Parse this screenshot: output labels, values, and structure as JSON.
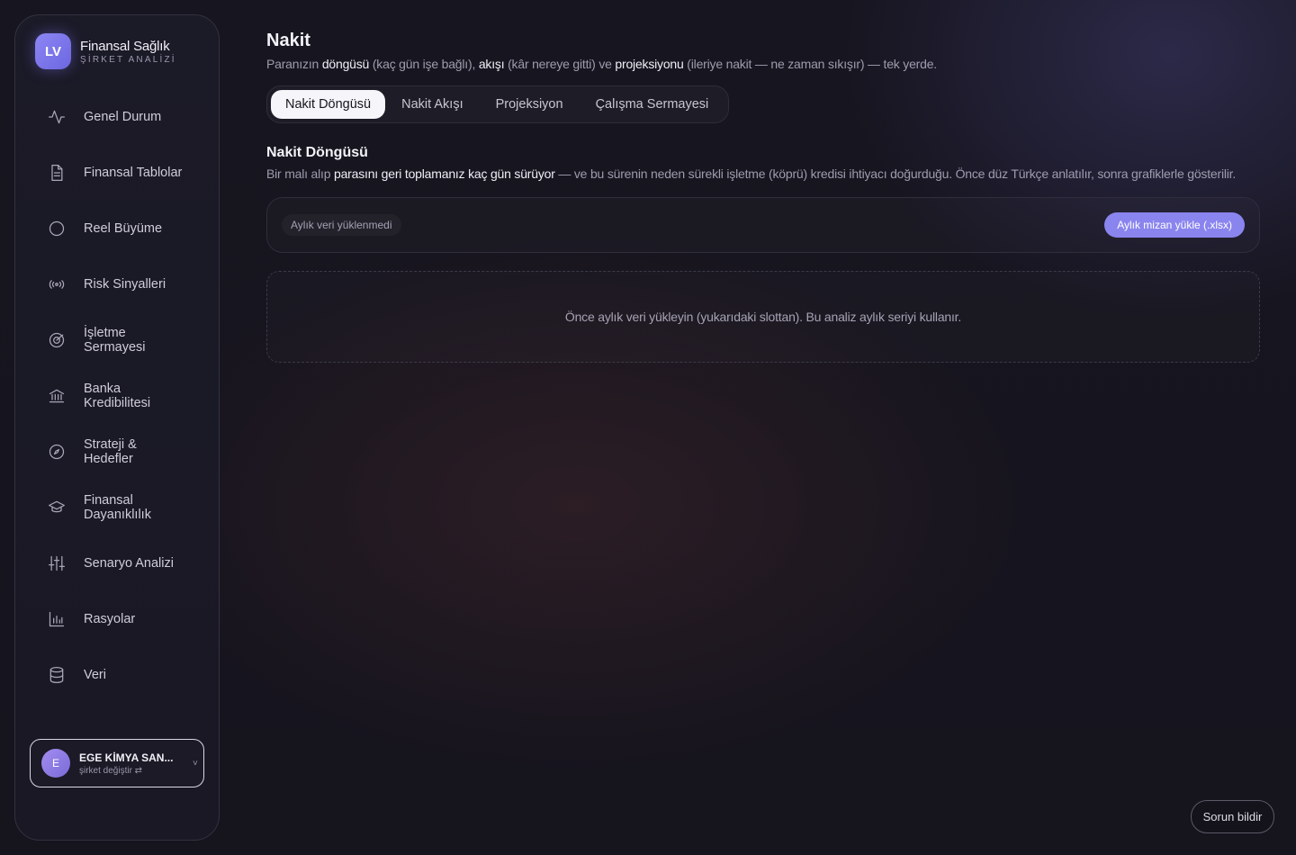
{
  "brand": {
    "logo": "LV",
    "title": "Finansal Sağlık",
    "subtitle": "ŞİRKET ANALİZİ"
  },
  "sidebar": {
    "items": [
      {
        "label": "Genel Durum",
        "icon": "activity-icon"
      },
      {
        "label": "Finansal Tablolar",
        "icon": "document-icon"
      },
      {
        "label": "Reel Büyüme",
        "icon": "circle-icon"
      },
      {
        "label": "Risk Sinyalleri",
        "icon": "signal-icon"
      },
      {
        "label": "İşletme Sermayesi",
        "icon": "target-icon"
      },
      {
        "label": "Banka Kredibilitesi",
        "icon": "bank-icon"
      },
      {
        "label": "Strateji & Hedefler",
        "icon": "compass-icon"
      },
      {
        "label": "Finansal Dayanıklılık",
        "icon": "graduation-cap-icon"
      },
      {
        "label": "Senaryo Analizi",
        "icon": "sliders-icon"
      },
      {
        "label": "Rasyolar",
        "icon": "bar-chart-icon"
      },
      {
        "label": "Veri",
        "icon": "database-icon"
      }
    ],
    "company": {
      "avatar": "E",
      "name": "EGE KİMYA SAN...",
      "sub": "şirket değiştir ⇄",
      "chevron": "˅"
    }
  },
  "header": {
    "title": "Nakit",
    "subtitle": {
      "p1": "Paranızın ",
      "b1": "döngüsü",
      "p2": " (kaç gün işe bağlı), ",
      "b2": "akışı",
      "p3": " (kâr nereye gitti) ve ",
      "b3": "projeksiyonu",
      "p4": " (ileriye nakit — ne zaman sıkışır) — tek yerde."
    }
  },
  "tabs": [
    {
      "label": "Nakit Döngüsü",
      "active": true
    },
    {
      "label": "Nakit Akışı",
      "active": false
    },
    {
      "label": "Projeksiyon",
      "active": false
    },
    {
      "label": "Çalışma Sermayesi",
      "active": false
    }
  ],
  "section": {
    "title": "Nakit Döngüsü",
    "desc": {
      "p1": "Bir malı alıp ",
      "b1": "parasını geri toplamanız kaç gün sürüyor",
      "p2": " — ve bu sürenin neden sürekli işletme (köprü) kredisi ihtiyacı doğurduğu. Önce düz Türkçe anlatılır, sonra grafiklerle gösterilir."
    }
  },
  "upload": {
    "status": "Aylık veri yüklenmedi",
    "button": "Aylık mizan yükle (.xlsx)"
  },
  "empty": {
    "message": "Önce aylık veri yükleyin (yukarıdaki slottan). Bu analiz aylık seriyi kullanır."
  },
  "footer": {
    "report": "Sorun bildir"
  },
  "colors": {
    "accent": "#8a84ef",
    "background": "#17151f",
    "sidebar": "#1b1a27"
  }
}
